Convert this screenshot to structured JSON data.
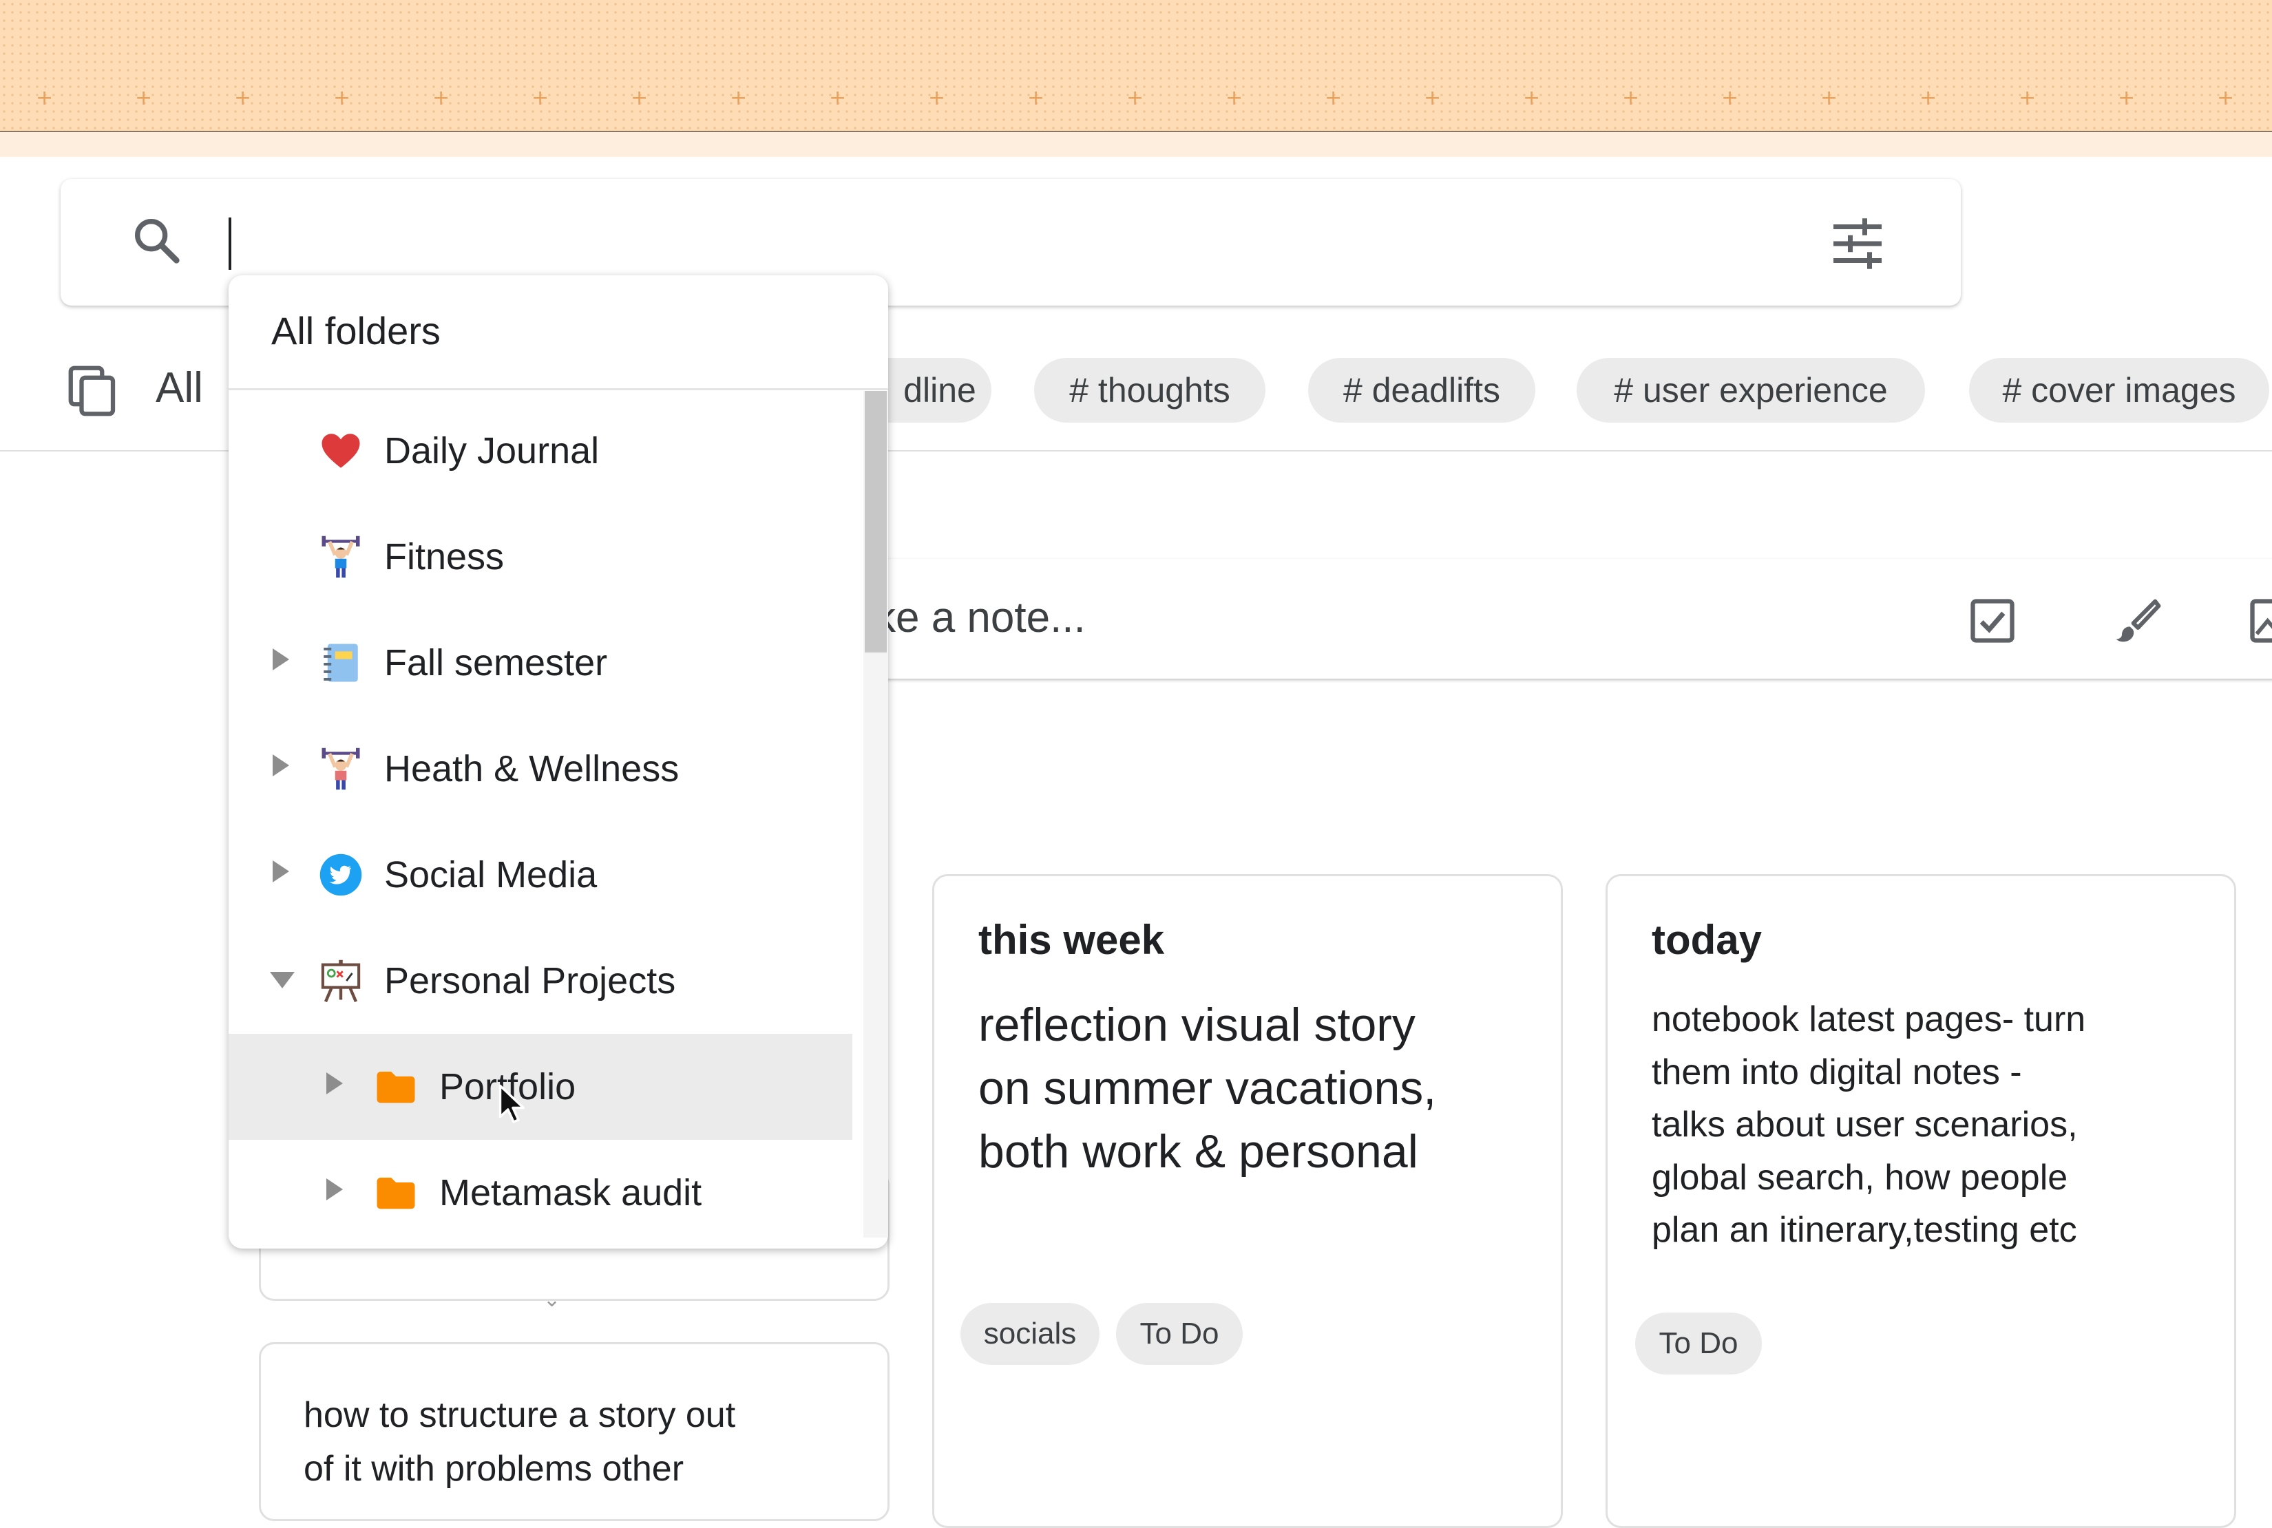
{
  "search": {
    "value": "",
    "filter_icon": "tune-icon"
  },
  "chips": {
    "all_label": "All",
    "items": [
      "dline",
      "# thoughts",
      "# deadlifts",
      "# user experience",
      "# cover images"
    ]
  },
  "note_input": {
    "placeholder_text": "ke a note..."
  },
  "folder_dropdown": {
    "header": "All folders",
    "items": [
      {
        "label": "Daily Journal",
        "icon": "heart-icon",
        "expander": "none"
      },
      {
        "label": "Fitness",
        "icon": "weightlifter-icon",
        "expander": "none"
      },
      {
        "label": "Fall semester",
        "icon": "notebook-icon",
        "expander": "collapsed"
      },
      {
        "label": "Heath & Wellness",
        "icon": "weightlifter-icon",
        "expander": "collapsed"
      },
      {
        "label": "Social Media",
        "icon": "twitter-icon",
        "expander": "collapsed"
      },
      {
        "label": "Personal Projects",
        "icon": "easel-icon",
        "expander": "expanded"
      },
      {
        "label": "Portfolio",
        "icon": "folder-icon",
        "expander": "collapsed",
        "selected": true
      },
      {
        "label": "Metamask audit",
        "icon": "folder-icon",
        "expander": "collapsed"
      }
    ]
  },
  "cards": {
    "this_week": {
      "title": "this week",
      "body_lines": [
        "reflection visual story",
        "on summer vacations,",
        "both work & personal"
      ],
      "tags": [
        "socials",
        "To Do"
      ]
    },
    "today": {
      "title": "today",
      "body_lines": [
        "notebook latest pages- turn",
        "them into digital notes -",
        "talks about user scenarios,",
        "global search, how people",
        "plan an itinerary,testing etc"
      ],
      "tags": [
        "To Do"
      ]
    },
    "bottom_left": {
      "body_lines": [
        "how to structure a story out",
        "of it with problems other"
      ]
    }
  },
  "colors": {
    "banner": "#fddcb6",
    "chip_bg": "#ebebeb",
    "folder_orange": "#fb8c00",
    "selected_row": "#ebebeb"
  }
}
